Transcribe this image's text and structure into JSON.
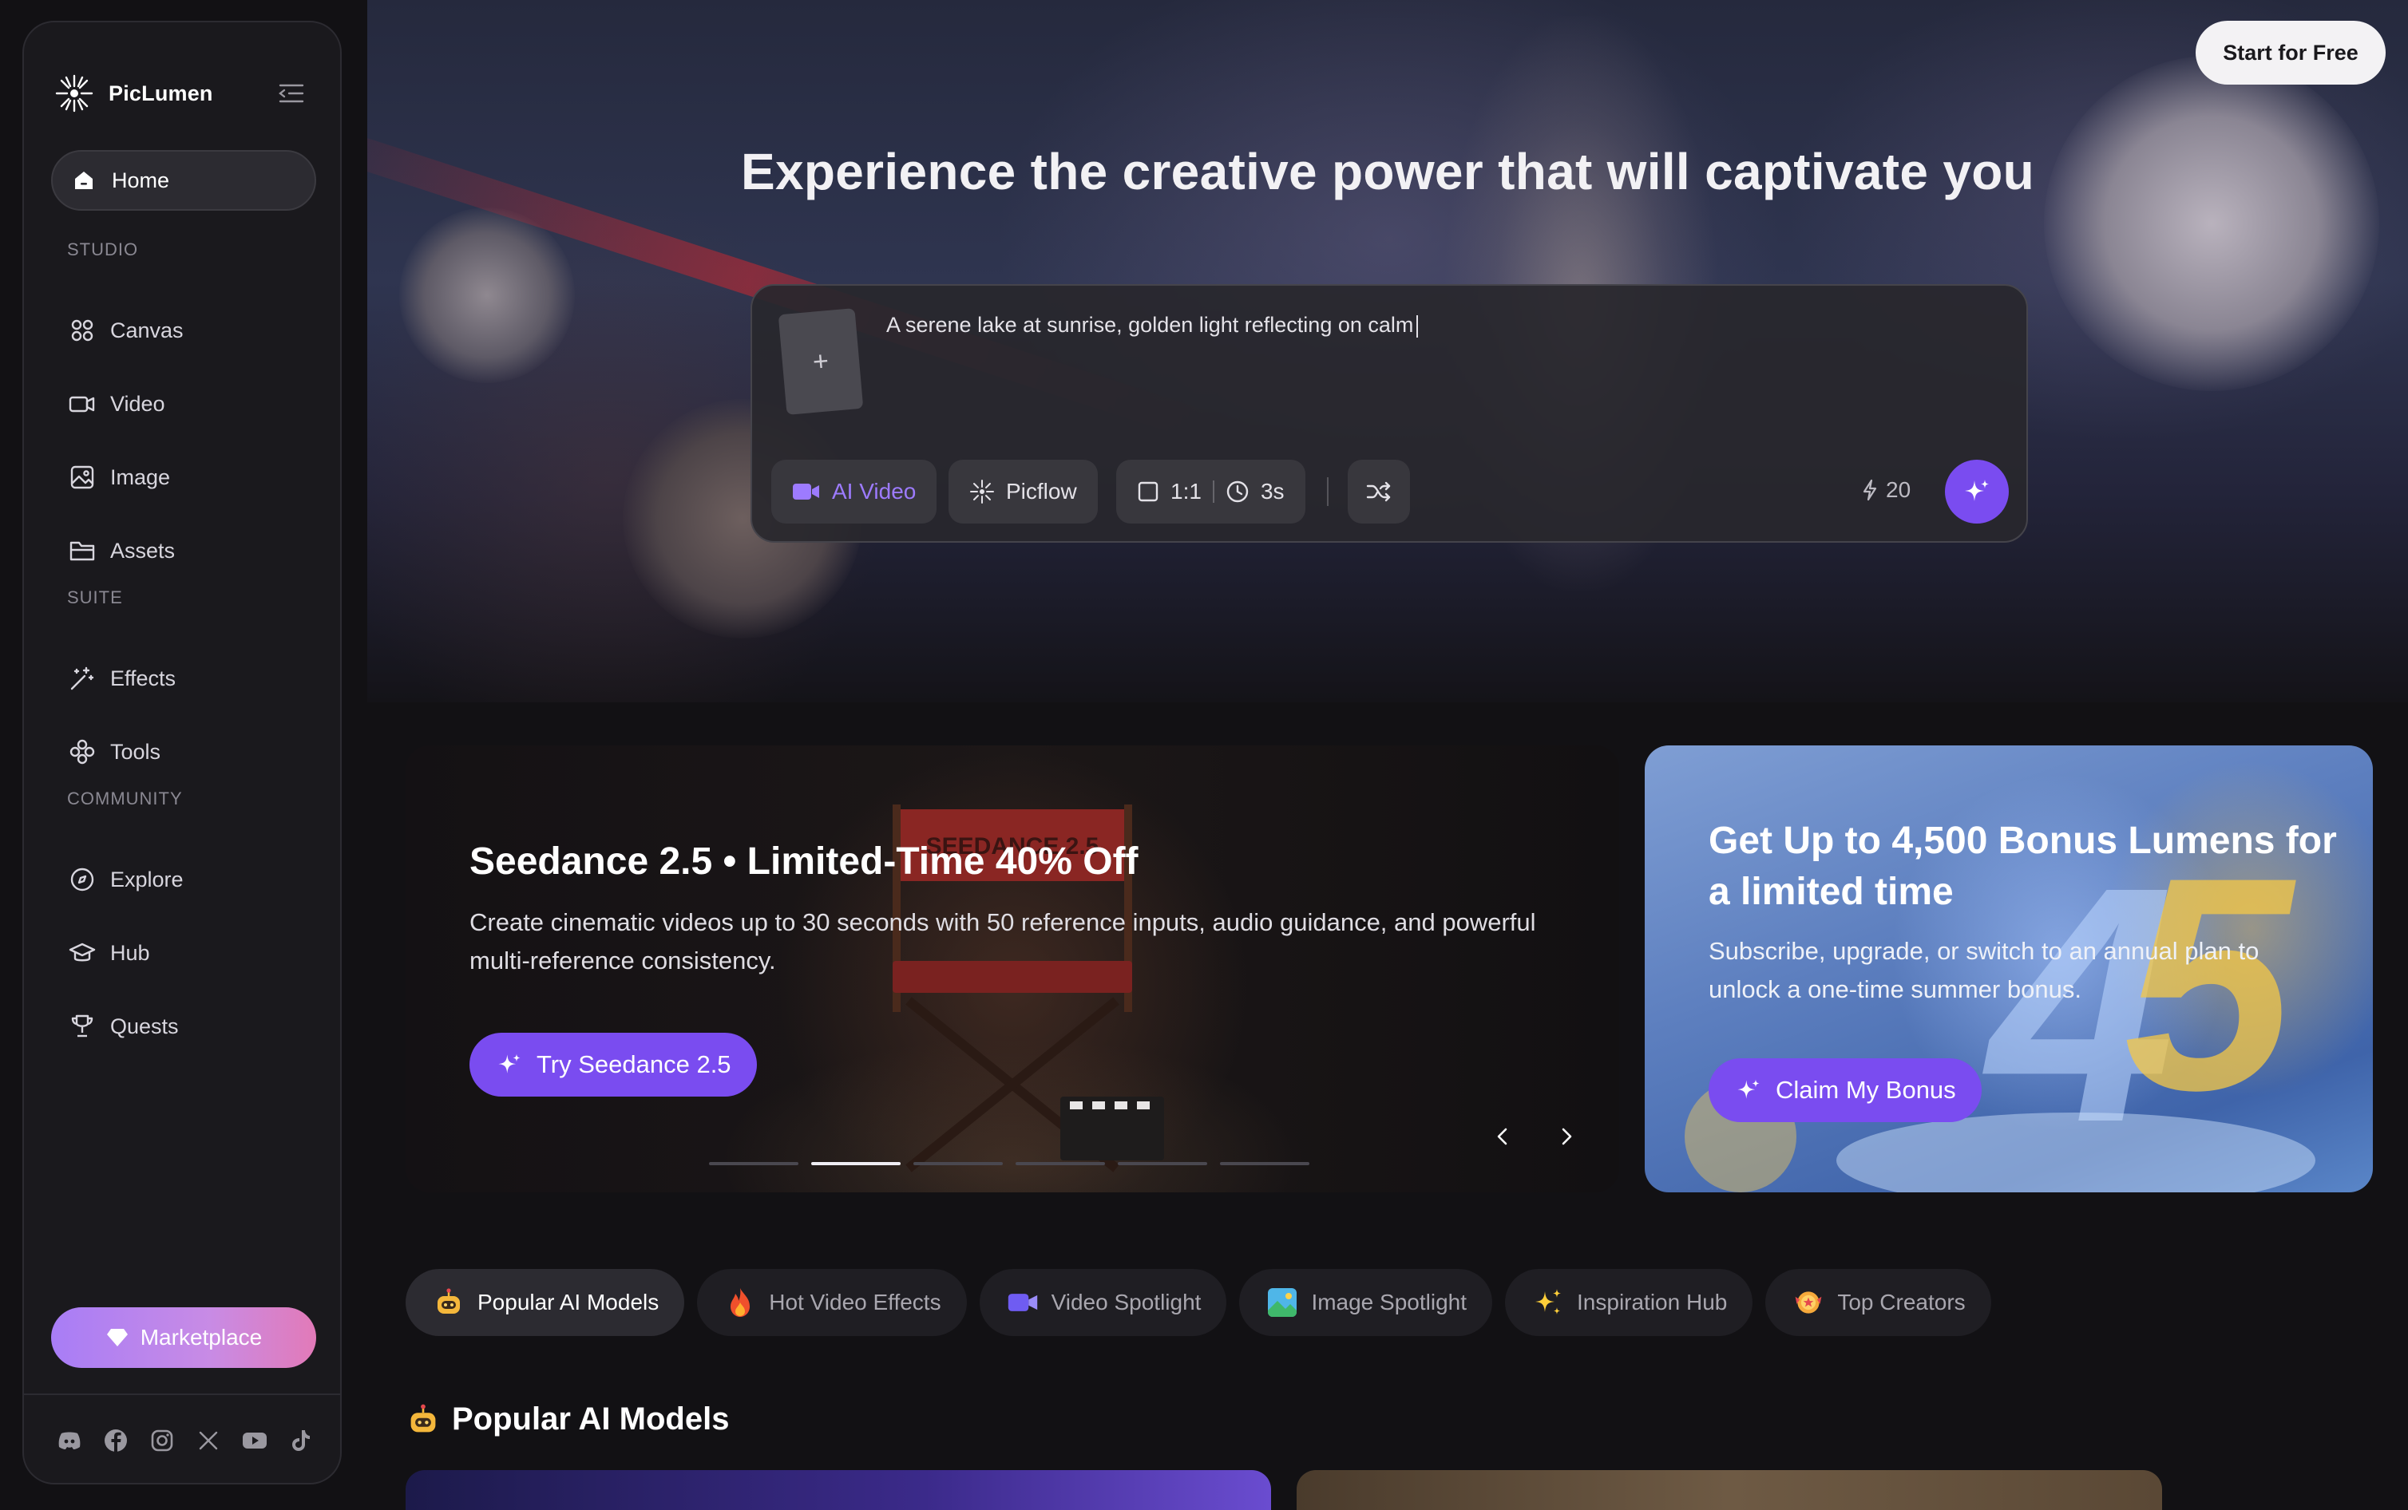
{
  "brand": {
    "name": "PicLumen"
  },
  "header": {
    "cta_label": "Start for Free"
  },
  "sidebar": {
    "home": "Home",
    "sections": [
      {
        "label": "STUDIO",
        "items": [
          "Canvas",
          "Video",
          "Image",
          "Assets"
        ]
      },
      {
        "label": "SUITE",
        "items": [
          "Effects",
          "Tools"
        ]
      },
      {
        "label": "COMMUNITY",
        "items": [
          "Explore",
          "Hub",
          "Quests"
        ]
      }
    ],
    "studio_label": "STUDIO",
    "suite_label": "SUITE",
    "community_label": "COMMUNITY",
    "canvas": "Canvas",
    "video": "Video",
    "image": "Image",
    "assets": "Assets",
    "effects": "Effects",
    "tools": "Tools",
    "explore": "Explore",
    "hub": "Hub",
    "quests": "Quests",
    "marketplace": "Marketplace",
    "socials": [
      "discord-icon",
      "facebook-icon",
      "instagram-icon",
      "x-icon",
      "youtube-icon",
      "tiktok-icon"
    ]
  },
  "hero": {
    "title": "Experience the creative power that will captivate you",
    "prompt_value": "A serene lake at sunrise, golden light reflecting on calm",
    "upload_symbol": "+",
    "mode_label": "AI Video",
    "model_label": "Picflow",
    "ratio_label": "1:1",
    "duration_label": "3s",
    "credits": "20"
  },
  "banners": {
    "main": {
      "title": "Seedance 2.5 • Limited-Time 40% Off",
      "description": "Create cinematic videos up to 30 seconds with 50 reference inputs, audio guidance, and powerful multi-reference consistency.",
      "button": "Try Seedance 2.5",
      "chair_text": "SEEDANCE 2.5",
      "active_slide": 2,
      "slide_count": 6
    },
    "side": {
      "title": "Get Up to 4,500 Bonus Lumens for a limited time",
      "description": "Subscribe, upgrade, or switch to an annual plan to unlock a one-time summer bonus.",
      "button": "Claim My Bonus"
    }
  },
  "tabs": [
    {
      "label": "Popular AI Models",
      "icon": "robot-emoji-icon",
      "active": true
    },
    {
      "label": "Hot Video Effects",
      "icon": "fire-emoji-icon",
      "active": false
    },
    {
      "label": "Video Spotlight",
      "icon": "video-camera-icon",
      "active": false
    },
    {
      "label": "Image Spotlight",
      "icon": "landscape-image-icon",
      "active": false
    },
    {
      "label": "Inspiration Hub",
      "icon": "sparkles-icon",
      "active": false
    },
    {
      "label": "Top Creators",
      "icon": "medal-icon",
      "active": false
    }
  ],
  "section": {
    "title": "Popular AI Models"
  },
  "colors": {
    "accent": "#7a4cf0",
    "background": "#121114",
    "sidebar": "#1a191d"
  }
}
